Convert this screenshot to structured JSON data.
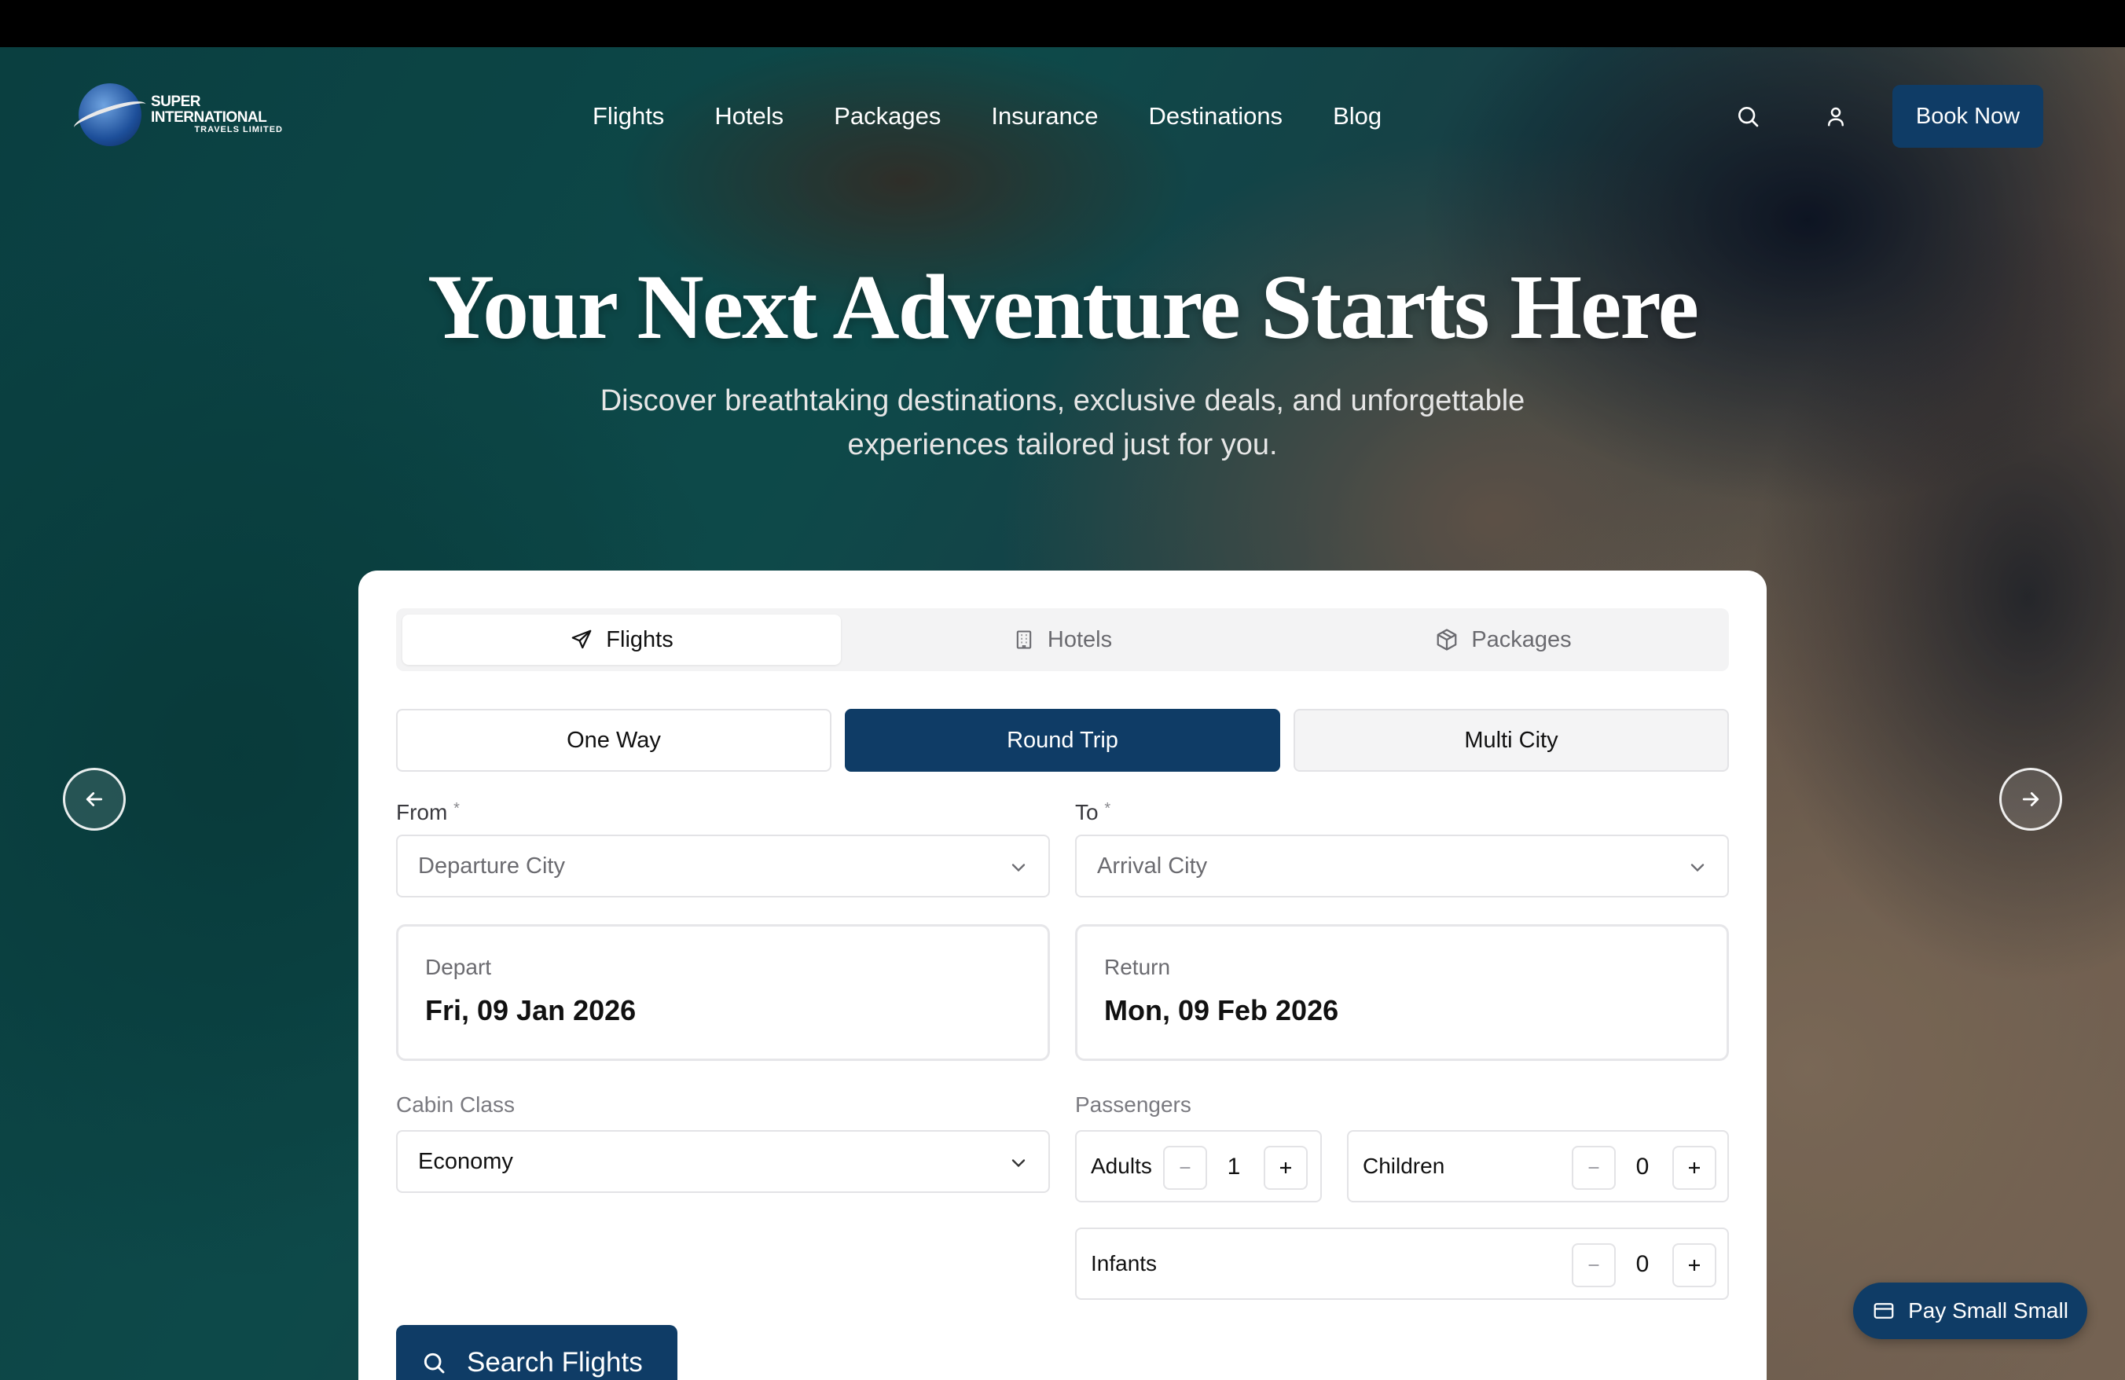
{
  "brand": {
    "name_line1": "SUPER INTERNATIONAL",
    "name_line2": "TRAVELS LIMITED"
  },
  "nav": {
    "items": [
      "Flights",
      "Hotels",
      "Packages",
      "Insurance",
      "Destinations",
      "Blog"
    ],
    "book_label": "Book Now"
  },
  "hero": {
    "title": "Your Next Adventure Starts Here",
    "subtitle": "Discover breathtaking destinations, exclusive deals, and unforgettable experiences tailored just for you."
  },
  "search": {
    "tabs": [
      {
        "label": "Flights",
        "icon": "plane-icon",
        "active": true
      },
      {
        "label": "Hotels",
        "icon": "building-icon",
        "active": false
      },
      {
        "label": "Packages",
        "icon": "package-icon",
        "active": false
      }
    ],
    "trip_types": [
      {
        "label": "One Way",
        "active": false
      },
      {
        "label": "Round Trip",
        "active": true
      },
      {
        "label": "Multi City",
        "active": false
      }
    ],
    "from_label": "From",
    "from_placeholder": "Departure City",
    "to_label": "To",
    "to_placeholder": "Arrival City",
    "required_mark": "*",
    "depart_label": "Depart",
    "depart_value": "Fri, 09 Jan 2026",
    "return_label": "Return",
    "return_value": "Mon, 09 Feb 2026",
    "cabin_label": "Cabin Class",
    "cabin_value": "Economy",
    "passengers_label": "Passengers",
    "adults_label": "Adults",
    "adults_value": "1",
    "children_label": "Children",
    "children_value": "0",
    "infants_label": "Infants",
    "infants_value": "0",
    "submit_label": "Search Flights"
  },
  "floating": {
    "pay_label": "Pay Small Small"
  },
  "colors": {
    "primary": "#0f3c66",
    "tab_bg": "#f3f3f4",
    "border": "#e3e3e6"
  }
}
